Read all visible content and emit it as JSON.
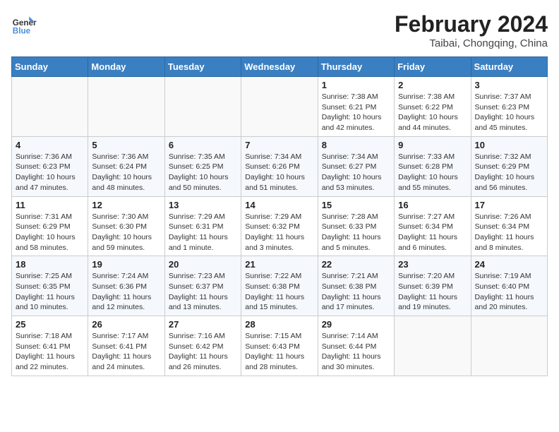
{
  "header": {
    "logo_line1": "General",
    "logo_line2": "Blue",
    "month": "February 2024",
    "location": "Taibai, Chongqing, China"
  },
  "weekdays": [
    "Sunday",
    "Monday",
    "Tuesday",
    "Wednesday",
    "Thursday",
    "Friday",
    "Saturday"
  ],
  "weeks": [
    [
      {
        "day": "",
        "info": ""
      },
      {
        "day": "",
        "info": ""
      },
      {
        "day": "",
        "info": ""
      },
      {
        "day": "",
        "info": ""
      },
      {
        "day": "1",
        "info": "Sunrise: 7:38 AM\nSunset: 6:21 PM\nDaylight: 10 hours and 42 minutes."
      },
      {
        "day": "2",
        "info": "Sunrise: 7:38 AM\nSunset: 6:22 PM\nDaylight: 10 hours and 44 minutes."
      },
      {
        "day": "3",
        "info": "Sunrise: 7:37 AM\nSunset: 6:23 PM\nDaylight: 10 hours and 45 minutes."
      }
    ],
    [
      {
        "day": "4",
        "info": "Sunrise: 7:36 AM\nSunset: 6:23 PM\nDaylight: 10 hours and 47 minutes."
      },
      {
        "day": "5",
        "info": "Sunrise: 7:36 AM\nSunset: 6:24 PM\nDaylight: 10 hours and 48 minutes."
      },
      {
        "day": "6",
        "info": "Sunrise: 7:35 AM\nSunset: 6:25 PM\nDaylight: 10 hours and 50 minutes."
      },
      {
        "day": "7",
        "info": "Sunrise: 7:34 AM\nSunset: 6:26 PM\nDaylight: 10 hours and 51 minutes."
      },
      {
        "day": "8",
        "info": "Sunrise: 7:34 AM\nSunset: 6:27 PM\nDaylight: 10 hours and 53 minutes."
      },
      {
        "day": "9",
        "info": "Sunrise: 7:33 AM\nSunset: 6:28 PM\nDaylight: 10 hours and 55 minutes."
      },
      {
        "day": "10",
        "info": "Sunrise: 7:32 AM\nSunset: 6:29 PM\nDaylight: 10 hours and 56 minutes."
      }
    ],
    [
      {
        "day": "11",
        "info": "Sunrise: 7:31 AM\nSunset: 6:29 PM\nDaylight: 10 hours and 58 minutes."
      },
      {
        "day": "12",
        "info": "Sunrise: 7:30 AM\nSunset: 6:30 PM\nDaylight: 10 hours and 59 minutes."
      },
      {
        "day": "13",
        "info": "Sunrise: 7:29 AM\nSunset: 6:31 PM\nDaylight: 11 hours and 1 minute."
      },
      {
        "day": "14",
        "info": "Sunrise: 7:29 AM\nSunset: 6:32 PM\nDaylight: 11 hours and 3 minutes."
      },
      {
        "day": "15",
        "info": "Sunrise: 7:28 AM\nSunset: 6:33 PM\nDaylight: 11 hours and 5 minutes."
      },
      {
        "day": "16",
        "info": "Sunrise: 7:27 AM\nSunset: 6:34 PM\nDaylight: 11 hours and 6 minutes."
      },
      {
        "day": "17",
        "info": "Sunrise: 7:26 AM\nSunset: 6:34 PM\nDaylight: 11 hours and 8 minutes."
      }
    ],
    [
      {
        "day": "18",
        "info": "Sunrise: 7:25 AM\nSunset: 6:35 PM\nDaylight: 11 hours and 10 minutes."
      },
      {
        "day": "19",
        "info": "Sunrise: 7:24 AM\nSunset: 6:36 PM\nDaylight: 11 hours and 12 minutes."
      },
      {
        "day": "20",
        "info": "Sunrise: 7:23 AM\nSunset: 6:37 PM\nDaylight: 11 hours and 13 minutes."
      },
      {
        "day": "21",
        "info": "Sunrise: 7:22 AM\nSunset: 6:38 PM\nDaylight: 11 hours and 15 minutes."
      },
      {
        "day": "22",
        "info": "Sunrise: 7:21 AM\nSunset: 6:38 PM\nDaylight: 11 hours and 17 minutes."
      },
      {
        "day": "23",
        "info": "Sunrise: 7:20 AM\nSunset: 6:39 PM\nDaylight: 11 hours and 19 minutes."
      },
      {
        "day": "24",
        "info": "Sunrise: 7:19 AM\nSunset: 6:40 PM\nDaylight: 11 hours and 20 minutes."
      }
    ],
    [
      {
        "day": "25",
        "info": "Sunrise: 7:18 AM\nSunset: 6:41 PM\nDaylight: 11 hours and 22 minutes."
      },
      {
        "day": "26",
        "info": "Sunrise: 7:17 AM\nSunset: 6:41 PM\nDaylight: 11 hours and 24 minutes."
      },
      {
        "day": "27",
        "info": "Sunrise: 7:16 AM\nSunset: 6:42 PM\nDaylight: 11 hours and 26 minutes."
      },
      {
        "day": "28",
        "info": "Sunrise: 7:15 AM\nSunset: 6:43 PM\nDaylight: 11 hours and 28 minutes."
      },
      {
        "day": "29",
        "info": "Sunrise: 7:14 AM\nSunset: 6:44 PM\nDaylight: 11 hours and 30 minutes."
      },
      {
        "day": "",
        "info": ""
      },
      {
        "day": "",
        "info": ""
      }
    ]
  ]
}
